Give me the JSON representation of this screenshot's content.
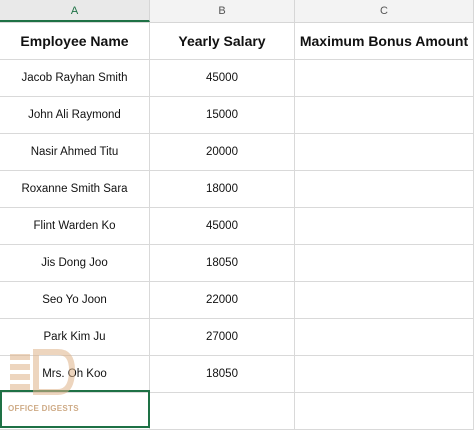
{
  "columns": [
    "A",
    "B",
    "C"
  ],
  "selected_column": "A",
  "headers": [
    "Employee Name",
    "Yearly Salary",
    "Maximum Bonus Amount"
  ],
  "rows": [
    [
      "Jacob Rayhan Smith",
      "45000",
      ""
    ],
    [
      "John Ali Raymond",
      "15000",
      ""
    ],
    [
      "Nasir Ahmed Titu",
      "20000",
      ""
    ],
    [
      "Roxanne Smith Sara",
      "18000",
      ""
    ],
    [
      "Flint Warden Ko",
      "45000",
      ""
    ],
    [
      "Jis Dong Joo",
      "18050",
      ""
    ],
    [
      "Seo Yo Joon",
      "22000",
      ""
    ],
    [
      "Park Kim Ju",
      "27000",
      ""
    ],
    [
      "Mrs. Oh Koo",
      "18050",
      ""
    ]
  ],
  "watermark": {
    "text": "OFFICE DIGESTS",
    "color": "#e0b48a"
  },
  "colors": {
    "selection": "#1e7145",
    "grid": "#d9d9d9"
  }
}
